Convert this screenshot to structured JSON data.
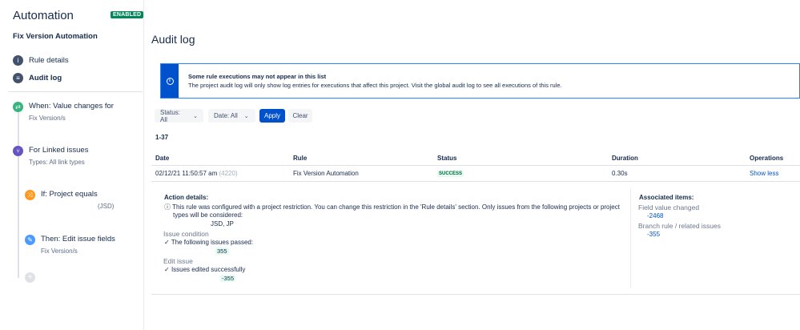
{
  "sidebar": {
    "app_title": "Automation",
    "badge": "ENABLED",
    "rule_name": "Fix Version Automation",
    "nav": [
      {
        "label": "Rule details",
        "icon": "info-icon"
      },
      {
        "label": "Audit log",
        "icon": "list-icon"
      }
    ],
    "steps": [
      {
        "label": "When: Value changes for",
        "sub": "Fix Version/s",
        "color": "#36b37e",
        "icon": "trigger-icon"
      },
      {
        "label": "For Linked issues",
        "sub": "Types: All link types",
        "color": "#6554c0",
        "icon": "branch-icon"
      },
      {
        "label": "If: Project equals",
        "sub": "(JSD)",
        "color": "#ff991f",
        "icon": "condition-icon"
      },
      {
        "label": "Then: Edit issue fields",
        "sub": "Fix Version/s",
        "color": "#4c9aff",
        "icon": "pencil-icon"
      }
    ],
    "add_icon": "plus-icon"
  },
  "main": {
    "title": "Audit log",
    "notice": {
      "title": "Some rule executions may not appear in this list",
      "body": "The project audit log will only show log entries for executions that affect this project. Visit the global audit log to see all executions of this rule."
    },
    "filters": {
      "status": "Status: All",
      "date": "Date: All",
      "apply": "Apply",
      "clear": "Clear"
    },
    "count": "1-37",
    "table": {
      "headers": [
        "Date",
        "Rule",
        "Status",
        "Duration",
        "Operations"
      ],
      "row": {
        "date": "02/12/21 11:50:57 am",
        "date_id": "(4220)",
        "rule": "Fix Version Automation",
        "status": "SUCCESS",
        "duration": "0.30s",
        "operation": "Show less"
      }
    },
    "details": {
      "action_title": "Action details:",
      "action_line1": "This rule was configured with a project restriction. You can change this restriction in the 'Rule details' section. Only issues from the following projects or project",
      "action_line2": "types will be considered:",
      "projects": "JSD, JP",
      "condition_title": "Issue condition",
      "condition_result": "The following issues passed:",
      "condition_issue": "355",
      "edit_title": "Edit issue",
      "edit_result": "Issues edited successfully",
      "edit_issue": "-355",
      "assoc_title": "Associated items:",
      "assoc_field": "Field value changed",
      "assoc_field_key": "-2468",
      "assoc_branch": "Branch rule / related issues",
      "assoc_branch_key": "-355"
    }
  },
  "colors": {
    "primary": "#0052cc",
    "success": "#00875a"
  }
}
